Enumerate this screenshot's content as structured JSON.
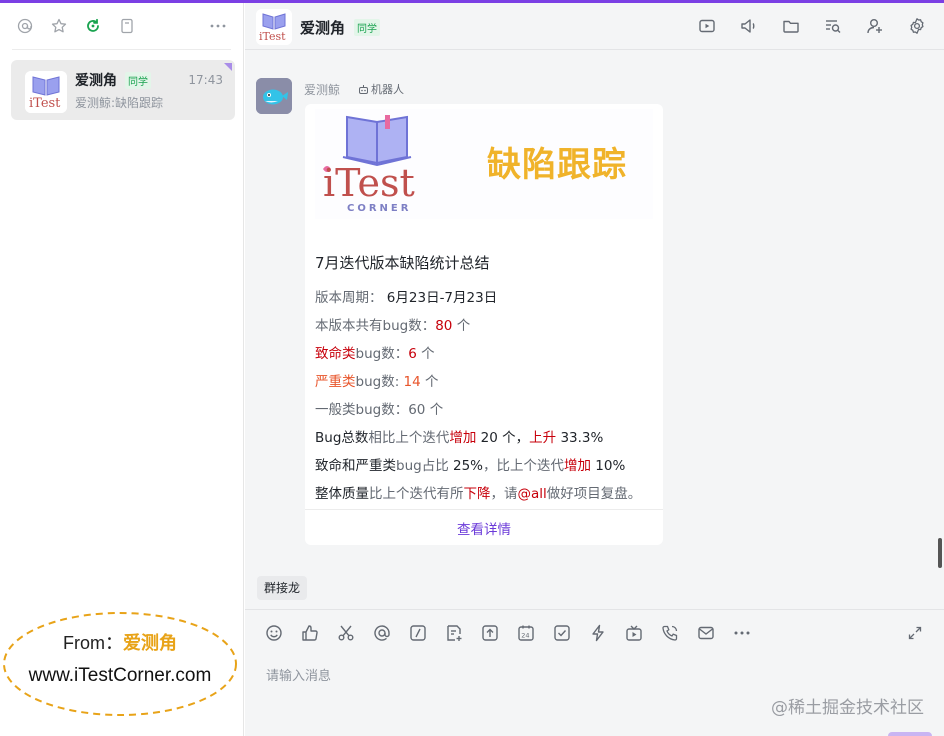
{
  "sidebar": {
    "toolbar_icons": [
      "at-icon",
      "star-icon",
      "refresh-icon",
      "bookmark-icon",
      "more-icon"
    ],
    "conversation": {
      "name": "爱测角",
      "tag": "同学",
      "time": "17:43",
      "preview": "爱测鲸:缺陷跟踪"
    },
    "watermark": {
      "from_label": "From：",
      "from_name": "爱测角",
      "url": "www.iTestCorner.com"
    }
  },
  "header": {
    "title": "爱测角",
    "tag": "同学",
    "icons": [
      "screen-share-icon",
      "announce-icon",
      "folder-icon",
      "search-history-icon",
      "add-member-icon",
      "settings-icon"
    ]
  },
  "message": {
    "sender": "爱测鲸",
    "bot_label": "机器人",
    "card": {
      "banner_title": "缺陷跟踪",
      "banner_logo": "iTest",
      "banner_sub": "CORNER",
      "title": "7月迭代版本缺陷统计总结",
      "lines": {
        "period_label": "版本周期：",
        "period_value": "6月23日-7月23日",
        "total_label": "本版本共有bug数：",
        "total_value": "80",
        "unit": "个",
        "fatal_label_a": "致命类",
        "fatal_label_b": "bug数：",
        "fatal_value": "6",
        "severe_label_a": "严重类",
        "severe_label_b": "bug数: ",
        "severe_value": "14",
        "normal_label": "一般类bug数：",
        "normal_value": "60",
        "l6_a": "Bug总数",
        "l6_b": "相比上个迭代",
        "l6_c": "增加",
        "l6_d": " 20 个，",
        "l6_e": "上升",
        "l6_f": " 33.3%",
        "l7_a": "致命和严重类",
        "l7_b": "bug占比 ",
        "l7_c": "25%",
        "l7_d": "，比上个迭代",
        "l7_e": "增加",
        "l7_f": " 10%",
        "l8_a": "整体质量",
        "l8_b": "比上个迭代有所",
        "l8_c": "下降",
        "l8_d": "，请",
        "l8_e": "@all",
        "l8_f": "做好项目复盘。"
      },
      "link": "查看详情"
    }
  },
  "composer": {
    "chip": "群接龙",
    "tools": [
      "emoji-icon",
      "thumbs-up-icon",
      "scissors-icon",
      "mention-icon",
      "slash-command-icon",
      "new-doc-icon",
      "upload-icon",
      "calendar-icon",
      "task-icon",
      "flash-icon",
      "live-icon",
      "call-icon",
      "mail-icon",
      "more-icon"
    ],
    "placeholder": "请输入消息"
  },
  "footer_watermark": "@稀土掘金技术社区",
  "colors": {
    "accent_purple": "#6b3ad9",
    "red": "#c7000b",
    "orange": "#e8542a",
    "tag_green": "#19a34f",
    "banner_yellow": "#f0b32a"
  }
}
